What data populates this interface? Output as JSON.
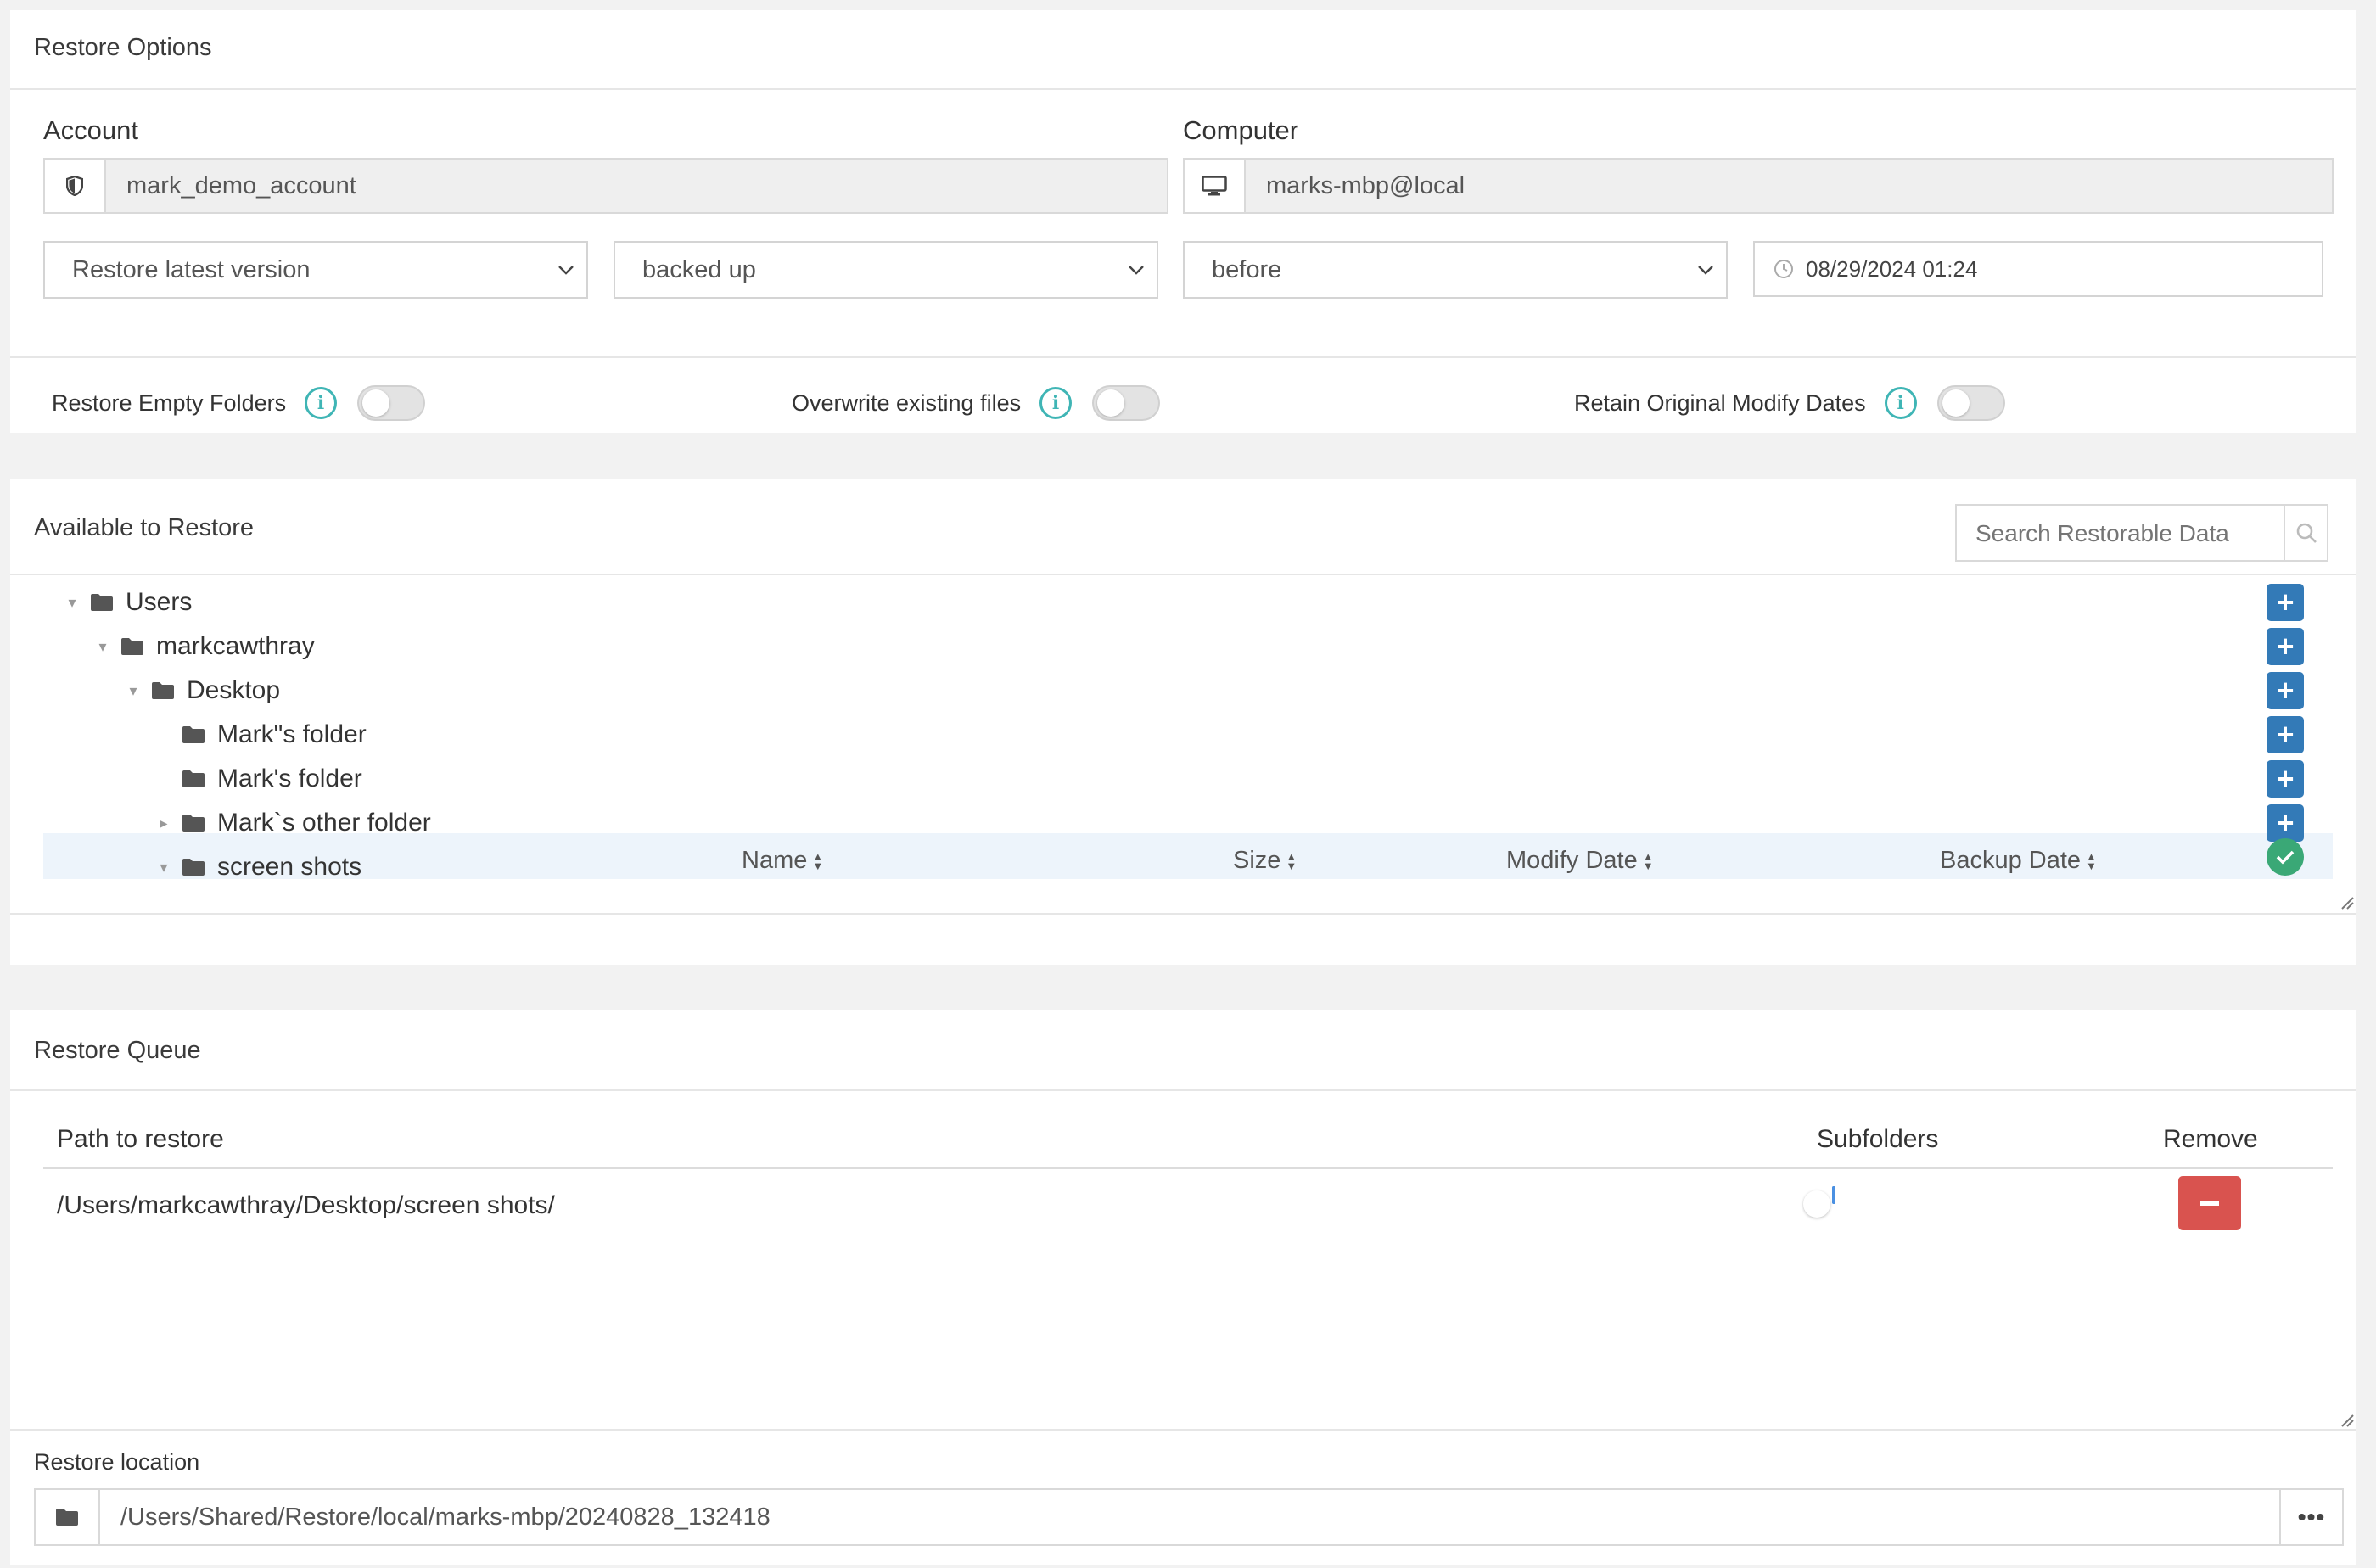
{
  "restore_options": {
    "title": "Restore Options",
    "account_label": "Account",
    "account_value": "mark_demo_account",
    "computer_label": "Computer",
    "computer_value": "marks-mbp@local",
    "version_select": "Restore latest version",
    "state_select": "backed up",
    "when_select": "before",
    "datetime_value": "08/29/2024 01:24",
    "opt_empty_folders": "Restore Empty Folders",
    "opt_overwrite": "Overwrite existing files",
    "opt_retain_dates": "Retain Original Modify Dates"
  },
  "available": {
    "title": "Available to Restore",
    "search_placeholder": "Search Restorable Data",
    "tree": [
      {
        "label": "Users",
        "level": 0,
        "caret": "down"
      },
      {
        "label": "markcawthray",
        "level": 1,
        "caret": "down"
      },
      {
        "label": "Desktop",
        "level": 2,
        "caret": "down"
      },
      {
        "label": "Mark\"s folder",
        "level": 3,
        "caret": "none"
      },
      {
        "label": "Mark's folder",
        "level": 3,
        "caret": "none"
      },
      {
        "label": "Mark`s other folder",
        "level": 3,
        "caret": "right"
      },
      {
        "label": "screen shots",
        "level": 3,
        "caret": "down"
      }
    ],
    "columns": {
      "name": "Name",
      "size": "Size",
      "modify_date": "Modify Date",
      "backup_date": "Backup Date"
    }
  },
  "queue": {
    "title": "Restore Queue",
    "col_path": "Path to restore",
    "col_subfolders": "Subfolders",
    "col_remove": "Remove",
    "rows": [
      {
        "path": "/Users/markcawthray/Desktop/screen shots/",
        "subfolders": true
      }
    ],
    "location_label": "Restore location",
    "location_value": "/Users/Shared/Restore/local/marks-mbp/20240828_132418"
  },
  "colors": {
    "primary": "#337ab7",
    "danger": "#d9534f",
    "success": "#3aa876",
    "info": "#3fb5b5",
    "toggle_on": "#4a90e2"
  }
}
